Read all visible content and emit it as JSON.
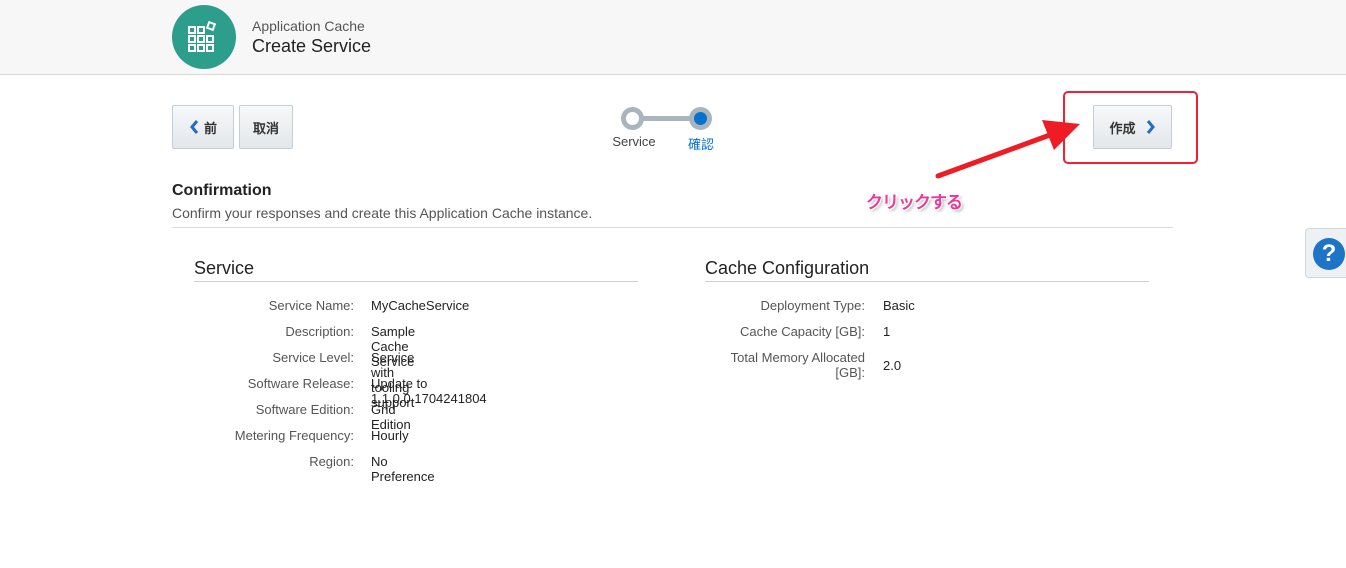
{
  "header": {
    "subtitle": "Application Cache",
    "title": "Create Service"
  },
  "toolbar": {
    "back_label": "前",
    "cancel_label": "取消",
    "create_label": "作成"
  },
  "train": {
    "steps": [
      {
        "label": "Service",
        "state": "done"
      },
      {
        "label": "確認",
        "state": "current"
      }
    ]
  },
  "annotation": {
    "text": "クリックする",
    "color": "#e8399a",
    "box_color": "#ee2233"
  },
  "confirmation": {
    "title": "Confirmation",
    "description": "Confirm your responses and create this Application Cache instance."
  },
  "service": {
    "title": "Service",
    "fields": [
      {
        "label": "Service Name:",
        "value": "MyCacheService"
      },
      {
        "label": "Description:",
        "value": "Sample Cache Service"
      },
      {
        "label": "Service Level:",
        "value": "Service with tooling support"
      },
      {
        "label": "Software Release:",
        "value": "Update to 1.1.0.0.1704241804"
      },
      {
        "label": "Software Edition:",
        "value": "Grid Edition"
      },
      {
        "label": "Metering Frequency:",
        "value": "Hourly"
      },
      {
        "label": "Region:",
        "value": "No Preference"
      }
    ]
  },
  "cache_config": {
    "title": "Cache Configuration",
    "fields": [
      {
        "label": "Deployment Type:",
        "value": "Basic"
      },
      {
        "label": "Cache Capacity [GB]:",
        "value": "1"
      },
      {
        "label_line1": "Total Memory Allocated",
        "label_line2": "[GB]:",
        "value": "2.0"
      }
    ]
  },
  "help": {
    "glyph": "?",
    "icon": "help-icon"
  },
  "colors": {
    "accent": "#0572ce",
    "app_icon": "#2d9e8b",
    "header_bg": "#f7f7f7"
  }
}
